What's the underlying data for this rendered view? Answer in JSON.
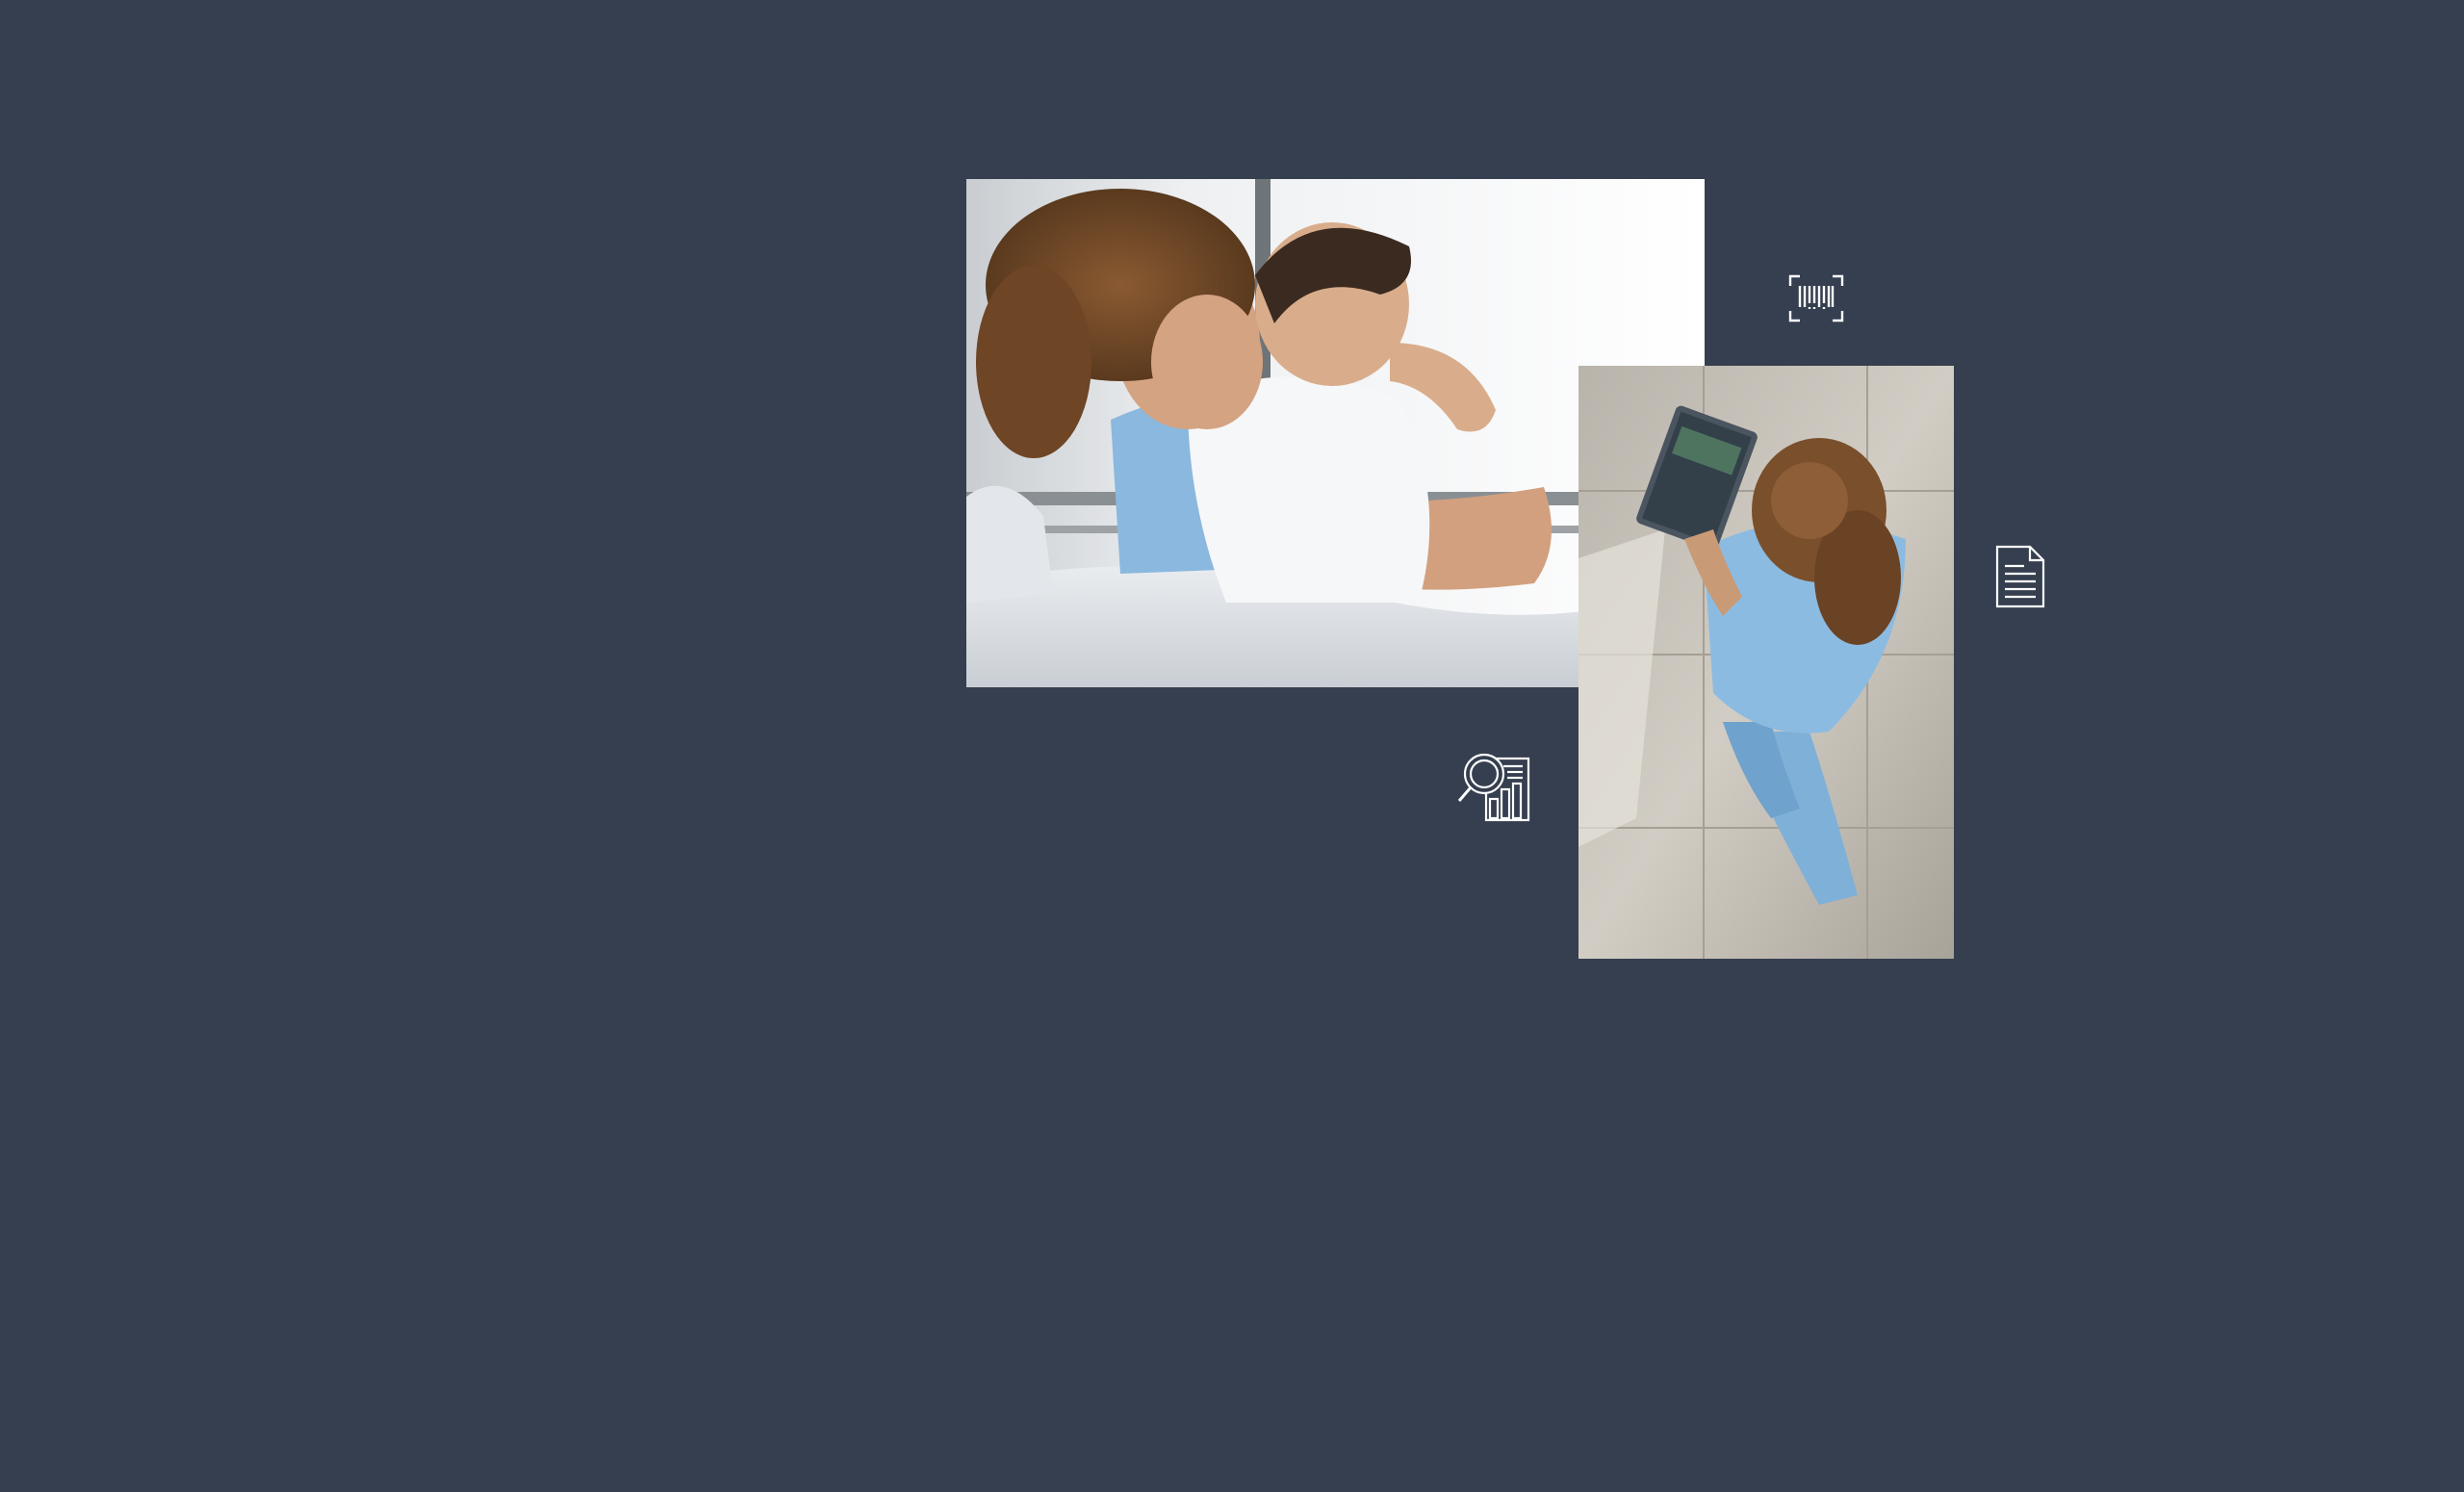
{
  "page": {
    "background_color": "#353f4f"
  },
  "images": {
    "hug": {
      "semantic": "nurse-hugging-child-photo"
    },
    "tablet": {
      "semantic": "nurse-walking-with-tablet-photo"
    }
  },
  "icons": {
    "barcode": "barcode-scan-icon",
    "document": "document-icon",
    "analytics": "magnifier-chart-icon",
    "color": "#ffffff"
  }
}
